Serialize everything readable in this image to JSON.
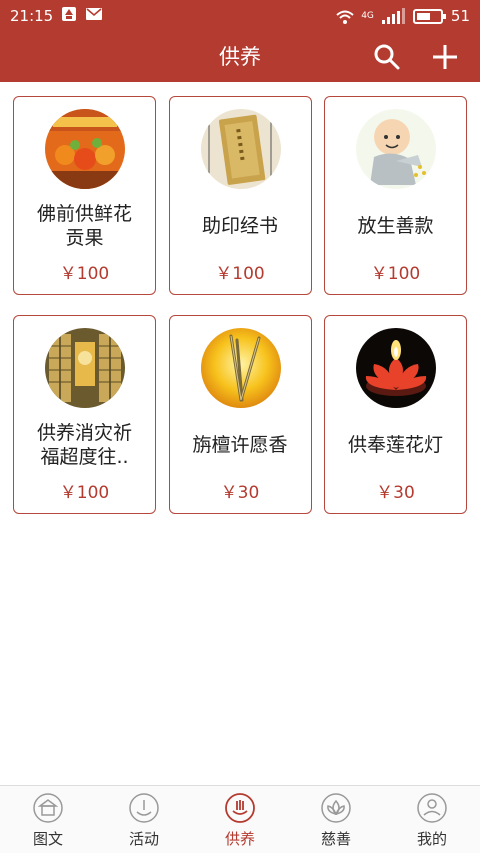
{
  "status": {
    "time": "21:15",
    "network": "4G",
    "battery": "51"
  },
  "header": {
    "title": "供养"
  },
  "items": [
    {
      "name": "佛前供鲜花\n贡果",
      "price": "￥100",
      "image": "fruit-offering"
    },
    {
      "name": "助印经书",
      "price": "￥100",
      "image": "scripture-book"
    },
    {
      "name": "放生善款",
      "price": "￥100",
      "image": "monk-cartoon"
    },
    {
      "name": "供养消灾祈\n福超度往..",
      "price": "￥100",
      "image": "memorial-tablets"
    },
    {
      "name": "旃檀许愿香",
      "price": "￥30",
      "image": "incense-sticks"
    },
    {
      "name": "供奉莲花灯",
      "price": "￥30",
      "image": "lotus-lamp"
    }
  ],
  "tabs": [
    {
      "label": "图文",
      "active": false
    },
    {
      "label": "活动",
      "active": false
    },
    {
      "label": "供养",
      "active": true
    },
    {
      "label": "慈善",
      "active": false
    },
    {
      "label": "我的",
      "active": false
    }
  ],
  "colors": {
    "brand": "#b43b30",
    "price": "#b43b30",
    "border": "#b5473c"
  }
}
